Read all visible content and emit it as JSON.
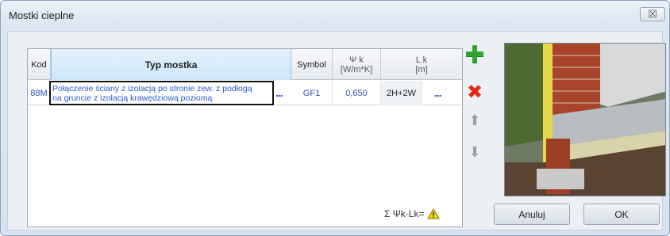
{
  "window": {
    "title": "Mostki cieplne",
    "close_label": "☒"
  },
  "grid": {
    "headers": {
      "kod": "Kod",
      "typ": "Typ mostka",
      "symbol": "Symbol",
      "psi_line1": "Ψ k",
      "psi_line2": "[W/m*K]",
      "l_line1": "L k",
      "l_line2": "[m]"
    },
    "rows": [
      {
        "kod": "88M",
        "typ_line1": "Połączenie ściany z izolacją po stronie zew. z podłogą",
        "typ_line2": "na gruncie z izolacją krawędziową poziomą",
        "symbol": "GF1",
        "psi": "0,650",
        "l": "2H+2W",
        "more": "..."
      }
    ]
  },
  "sidebar_icons": [
    "add-icon",
    "delete-icon",
    "arrow-up-icon",
    "arrow-down-icon"
  ],
  "summary": {
    "label": "Σ Ψk·Lk="
  },
  "buttons": {
    "cancel": "Anuluj",
    "ok": "OK"
  },
  "colors": {
    "add": "#2fa52f",
    "delete": "#e02a1b",
    "link_text": "#2b4fb3"
  }
}
